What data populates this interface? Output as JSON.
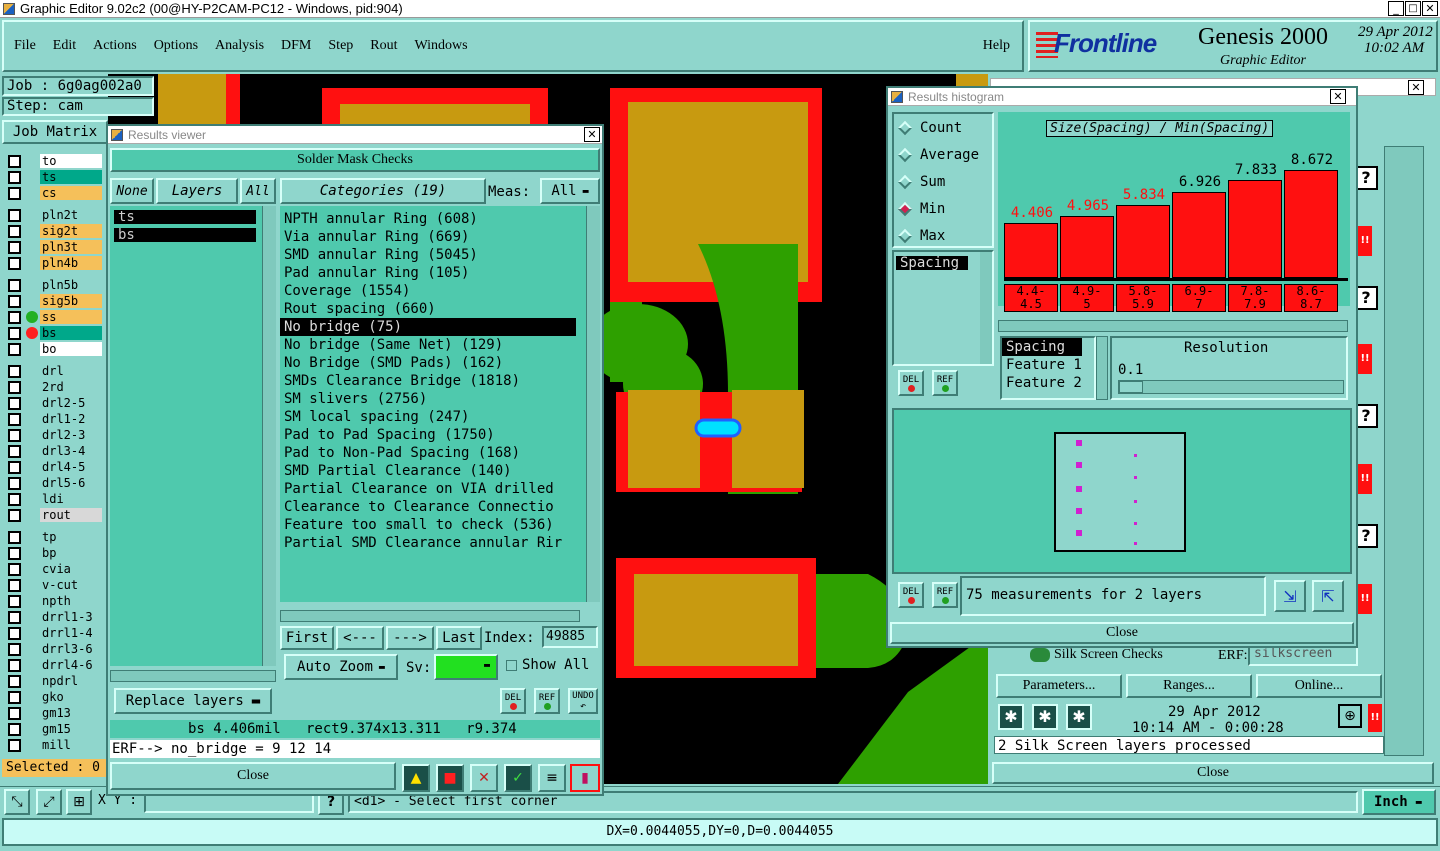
{
  "window": {
    "title": "Graphic Editor 9.02c2 (00@HY-P2CAM-PC12 - Windows, pid:904)"
  },
  "menu": [
    "File",
    "Edit",
    "Actions",
    "Options",
    "Analysis",
    "DFM",
    "Step",
    "Rout",
    "Windows"
  ],
  "help": "Help",
  "brand": {
    "logo": "Frontline",
    "product": "Genesis 2000",
    "subtitle": "Graphic Editor",
    "date": "29 Apr 2012",
    "time": "10:02 AM"
  },
  "job": {
    "job_label": "Job : 6g0ag002a0",
    "step_label": "Step: cam",
    "matrix": "Job Matrix"
  },
  "layers": [
    {
      "name": "to",
      "color": "#ffffff"
    },
    {
      "name": "ts",
      "color": "#00a88a"
    },
    {
      "name": "cs",
      "color": "#f5c05a"
    },
    {
      "name": "pln2t",
      "color": "#8fd6cc"
    },
    {
      "name": "sig2t",
      "color": "#f5c05a"
    },
    {
      "name": "pln3t",
      "color": "#f5c05a"
    },
    {
      "name": "pln4b",
      "color": "#f5c05a"
    },
    {
      "name": "pln5b",
      "color": "#8fd6cc"
    },
    {
      "name": "sig5b",
      "color": "#f5c05a"
    },
    {
      "name": "ss",
      "color": "#f5c05a"
    },
    {
      "name": "bs",
      "color": "#00a88a"
    },
    {
      "name": "bo",
      "color": "#ffffff"
    },
    {
      "name": "drl",
      "color": "#8fd6cc"
    },
    {
      "name": "2rd",
      "color": "#8fd6cc"
    },
    {
      "name": "drl2-5",
      "color": "#8fd6cc"
    },
    {
      "name": "drl1-2",
      "color": "#8fd6cc"
    },
    {
      "name": "drl2-3",
      "color": "#8fd6cc"
    },
    {
      "name": "drl3-4",
      "color": "#8fd6cc"
    },
    {
      "name": "drl4-5",
      "color": "#8fd6cc"
    },
    {
      "name": "drl5-6",
      "color": "#8fd6cc"
    },
    {
      "name": "ldi",
      "color": "#8fd6cc"
    },
    {
      "name": "rout",
      "color": "#d8d8d8"
    },
    {
      "name": "tp",
      "color": "#8fd6cc"
    },
    {
      "name": "bp",
      "color": "#8fd6cc"
    },
    {
      "name": "cvia",
      "color": "#8fd6cc"
    },
    {
      "name": "v-cut",
      "color": "#8fd6cc"
    },
    {
      "name": "npth",
      "color": "#8fd6cc"
    },
    {
      "name": "drrl1-3",
      "color": "#8fd6cc"
    },
    {
      "name": "drrl1-4",
      "color": "#8fd6cc"
    },
    {
      "name": "drrl3-6",
      "color": "#8fd6cc"
    },
    {
      "name": "drrl4-6",
      "color": "#8fd6cc"
    },
    {
      "name": "npdrl",
      "color": "#8fd6cc"
    },
    {
      "name": "gko",
      "color": "#8fd6cc"
    },
    {
      "name": "gm13",
      "color": "#8fd6cc"
    },
    {
      "name": "gm15",
      "color": "#8fd6cc"
    },
    {
      "name": "mill",
      "color": "#8fd6cc"
    }
  ],
  "selected_label": "Selected : 0",
  "results_viewer": {
    "title": "Results viewer",
    "header": "Solder Mask Checks",
    "none_btn": "None",
    "layers_btn": "Layers",
    "all_btn": "All",
    "layer_items": [
      "ts",
      "bs"
    ],
    "categories_btn": "Categories (19)",
    "meas_label": "Meas:",
    "meas_value": "All",
    "categories": [
      "NPTH annular Ring (608)",
      "Via annular Ring (669)",
      "SMD annular Ring (5045)",
      "Pad annular Ring (105)",
      "Coverage (1554)",
      "Rout spacing (660)",
      "No bridge (75)",
      "No bridge (Same Net) (129)",
      "No Bridge (SMD Pads) (162)",
      "SMDs Clearance Bridge (1818)",
      "SM slivers (2756)",
      "SM local spacing (247)",
      "Pad to Pad Spacing (1750)",
      "Pad to Non-Pad Spacing (168)",
      "SMD Partial Clearance (140)",
      "Partial Clearance on VIA drilled",
      "Clearance to Clearance Connectio",
      "Feature too small to check (536)",
      "Partial SMD Clearance annular Rir"
    ],
    "selected_category": 6,
    "first": "First",
    "prev": "<---",
    "next": "--->",
    "last": "Last",
    "index_label": "Index:",
    "index_value": "49885",
    "auto_zoom": "Auto Zoom",
    "sv_label": "Sv:",
    "show_all": "Show All",
    "replace_layers": "Replace layers",
    "del": "DEL",
    "ref": "REF",
    "undo": "UNDO",
    "status": "bs 4.406mil   rect9.374x13.311   r9.374",
    "erf": "ERF--> no_bridge = 9 12 14",
    "close": "Close"
  },
  "histogram": {
    "title": "Results histogram",
    "modes": [
      "Count",
      "Average",
      "Sum",
      "Min",
      "Max"
    ],
    "selected_mode": "Min",
    "measure_list": [
      "Spacing"
    ],
    "chart_title": "Size(Spacing) / Min(Spacing)",
    "bins": [
      "4.4-\n4.5",
      "4.9-\n5",
      "5.8-\n5.9",
      "6.9-\n7",
      "7.8-\n7.9",
      "8.6-\n8.7"
    ],
    "features": [
      "Spacing",
      "Feature 1",
      "Feature 2"
    ],
    "resolution_label": "Resolution",
    "resolution_value": "0.1",
    "del": "DEL",
    "ref": "REF",
    "measurements": "75 measurements for 2 layers",
    "close": "Close"
  },
  "chart_data": {
    "type": "bar",
    "title": "Size(Spacing) / Min(Spacing)",
    "categories": [
      "4.4-4.5",
      "4.9-5",
      "5.8-5.9",
      "6.9-7",
      "7.8-7.9",
      "8.6-8.7"
    ],
    "values": [
      4.406,
      4.965,
      5.834,
      6.926,
      7.833,
      8.672
    ],
    "value_labels": [
      "4.406",
      "4.965",
      "5.834",
      "6.926",
      "7.833",
      "8.672"
    ],
    "value_label_colors": [
      "#ff1010",
      "#ff1010",
      "#ff1010",
      "#000000",
      "#000000",
      "#000000"
    ],
    "bar_color": "#ff1010"
  },
  "silk": {
    "label": "Silk Screen Checks",
    "erf_label": "ERF:",
    "erf_value": "silkscreen",
    "parameters": "Parameters...",
    "ranges": "Ranges...",
    "online": "Online...",
    "date": "29 Apr 2012",
    "time": "10:14 AM - 0:00:28",
    "status": "2 Silk Screen layers processed",
    "close": "Close"
  },
  "bottom": {
    "x_label": "X Y :",
    "hint": "<d1> - Select first corner",
    "units": "Inch",
    "measure": "DX=0.0044055,DY=0,D=0.0044055"
  }
}
